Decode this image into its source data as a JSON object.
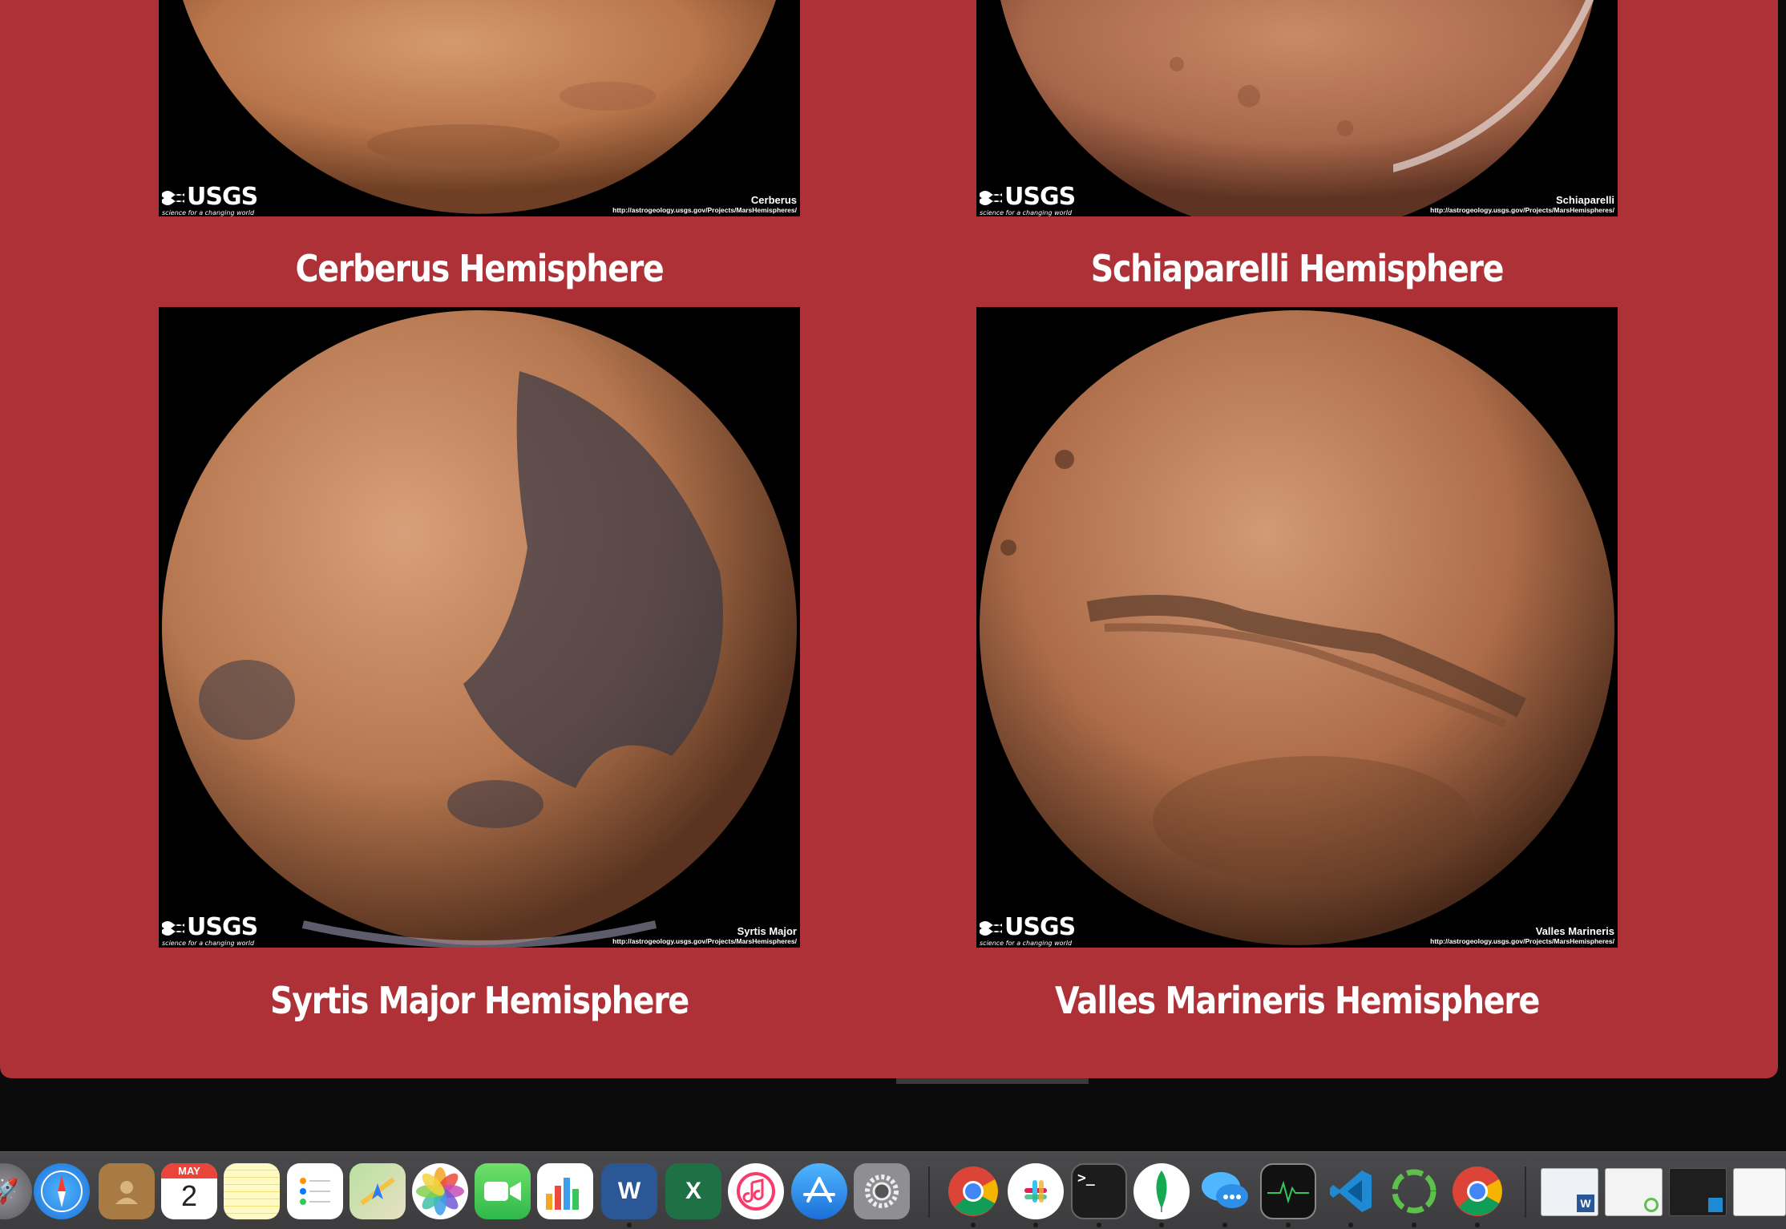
{
  "hemispheres": [
    {
      "title": "Cerberus Hemisphere",
      "image_label": "Cerberus"
    },
    {
      "title": "Schiaparelli Hemisphere",
      "image_label": "Schiaparelli"
    },
    {
      "title": "Syrtis Major Hemisphere",
      "image_label": "Syrtis Major"
    },
    {
      "title": "Valles Marineris Hemisphere",
      "image_label": "Valles Marineris"
    }
  ],
  "image_credit": {
    "logo": "USGS",
    "tagline": "science for a changing world",
    "url": "http://astrogeology.usgs.gov/Projects/MarsHemispheres/"
  },
  "colors": {
    "page_background": "#ad3136",
    "title_text": "#ffffff",
    "mars_surface": "#c07a52",
    "image_background": "#000000"
  },
  "dock": {
    "calendar_month": "MAY",
    "calendar_day": "2",
    "icons": [
      "launchpad-icon",
      "safari-icon",
      "contacts-icon",
      "calendar-icon",
      "notes-icon",
      "reminders-icon",
      "maps-icon",
      "photos-icon",
      "facetime-icon",
      "numbers-icon",
      "word-icon",
      "excel-icon",
      "itunes-icon",
      "app-store-icon",
      "system-preferences-icon",
      "chrome-icon",
      "slack-icon",
      "terminal-icon",
      "mongodb-compass-icon",
      "messages-icon",
      "activity-monitor-icon",
      "vscode-icon",
      "sync-icon",
      "chrome-icon-2",
      "window-thumbnail-1",
      "window-thumbnail-2",
      "window-thumbnail-3",
      "window-thumbnail-4"
    ]
  }
}
